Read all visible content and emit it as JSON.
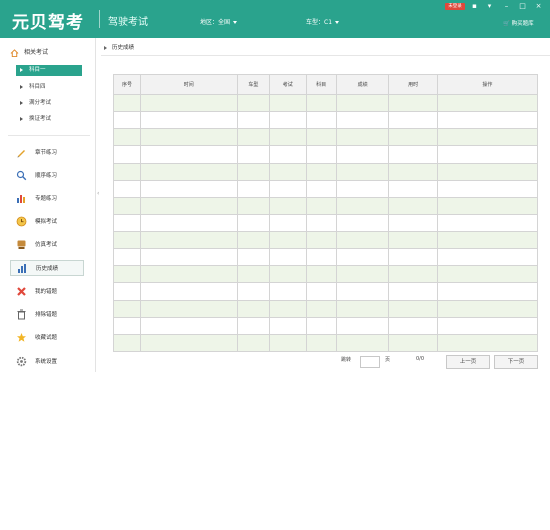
{
  "header": {
    "logo": "元贝驾考",
    "subtitle": "驾驶考试",
    "region_label": "地区：全国",
    "vehicle_label": "车型：C1",
    "badge": "未登录",
    "feedback": "购买题库",
    "brand_color": "#2aa38d"
  },
  "sidebar": {
    "heading": "相关考试",
    "subjects": [
      {
        "label": "科目一",
        "active": true
      },
      {
        "label": "科目四",
        "active": false
      },
      {
        "label": "满分考试",
        "active": false
      },
      {
        "label": "换证考试",
        "active": false
      }
    ],
    "nav": [
      {
        "label": "章节练习",
        "icon": "pencil-icon"
      },
      {
        "label": "顺序练习",
        "icon": "magnifier-icon"
      },
      {
        "label": "专题练习",
        "icon": "bar-chart-icon"
      },
      {
        "label": "模拟考试",
        "icon": "clock-icon"
      },
      {
        "label": "仿真考试",
        "icon": "stamp-icon"
      },
      {
        "label": "历史成绩",
        "icon": "chart-icon"
      },
      {
        "label": "我的错题",
        "icon": "cross-icon"
      },
      {
        "label": "排除错题",
        "icon": "trash-icon"
      },
      {
        "label": "收藏试题",
        "icon": "star-icon"
      },
      {
        "label": "系统设置",
        "icon": "gear-icon"
      }
    ]
  },
  "breadcrumb": "历史成绩",
  "table": {
    "headers": [
      "序号",
      "时间",
      "车型",
      "考试",
      "科目",
      "成绩",
      "用时",
      "操作"
    ],
    "rows": 15
  },
  "pager": {
    "jump_label": "跳转",
    "page_suffix": "页",
    "page_count": "0/0",
    "prev": "上一页",
    "next": "下一页"
  }
}
